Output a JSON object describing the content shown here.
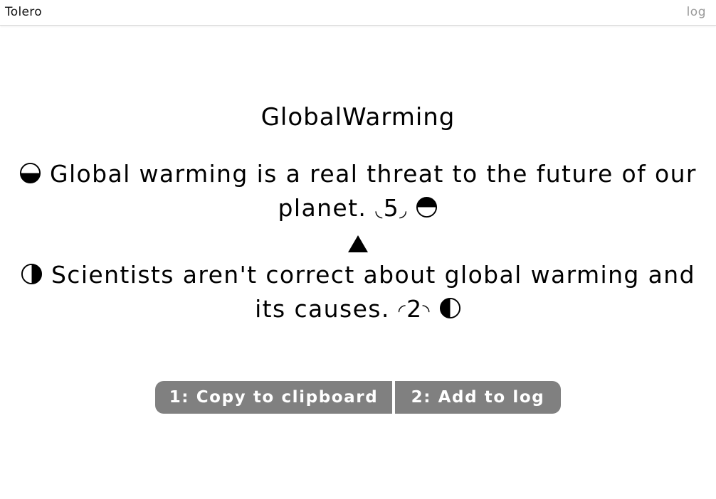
{
  "header": {
    "brand": "Tolero",
    "log_link": "log"
  },
  "main": {
    "title": "GlobalWarming",
    "statement_1": {
      "text": "Global warming is a real threat to the future of our planet.",
      "score": "5",
      "icon": "half-bottom-filled-circle-icon"
    },
    "relation_icon": "up-triangle-icon",
    "statement_2": {
      "text": "Scientists aren't correct about global warming and its causes.",
      "score": "2",
      "icon": "half-right-filled-circle-icon"
    }
  },
  "actions": {
    "copy_label": "1: Copy to clipboard",
    "add_label": "2: Add to log"
  },
  "colors": {
    "button_bg": "#808080",
    "button_text": "#ffffff",
    "log_link": "#999999"
  }
}
